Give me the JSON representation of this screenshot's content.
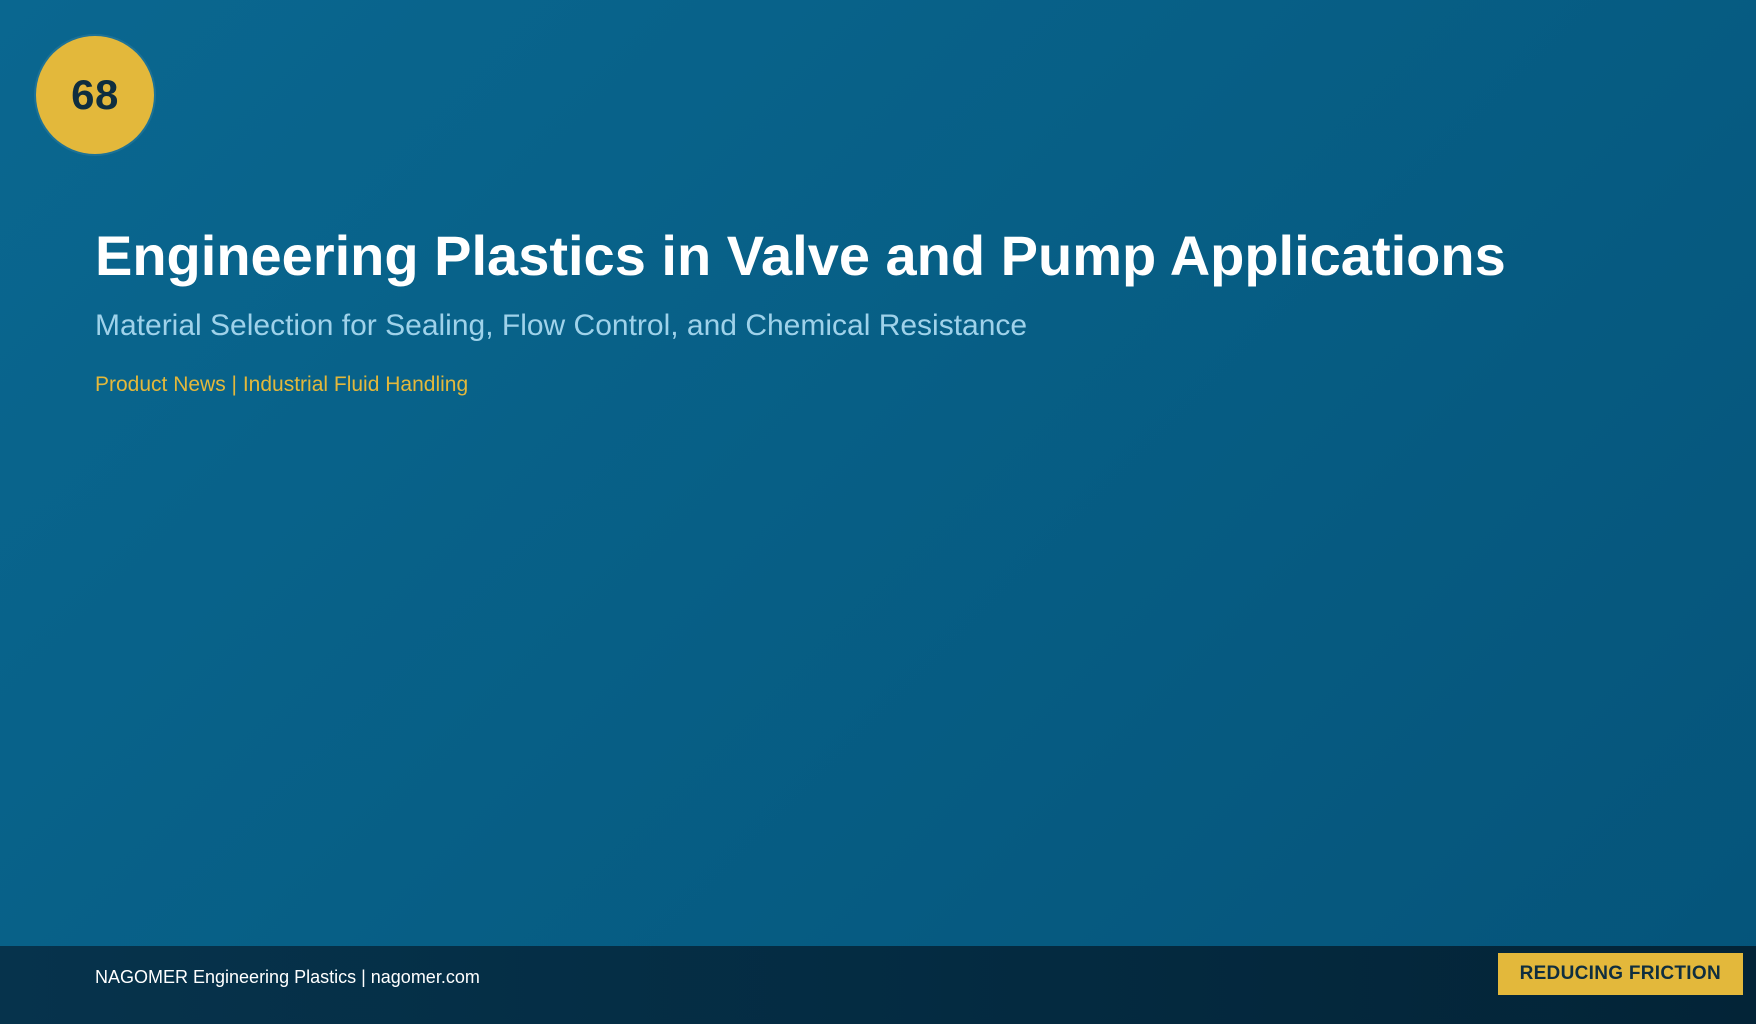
{
  "badge": {
    "number": "68"
  },
  "header": {
    "title": "Engineering Plastics in Valve and Pump Applications",
    "subtitle": "Material Selection for Sealing, Flow Control, and Chemical Resistance",
    "tagline": "Product News | Industrial Fluid Handling"
  },
  "footer": {
    "text": "NAGOMER Engineering Plastics | nagomer.com",
    "tag": "REDUCING FRICTION"
  },
  "colors": {
    "background": "#0a6790",
    "accent": "#e3b83b",
    "subtitle": "#9fd2ea",
    "footer": "#042a40"
  }
}
